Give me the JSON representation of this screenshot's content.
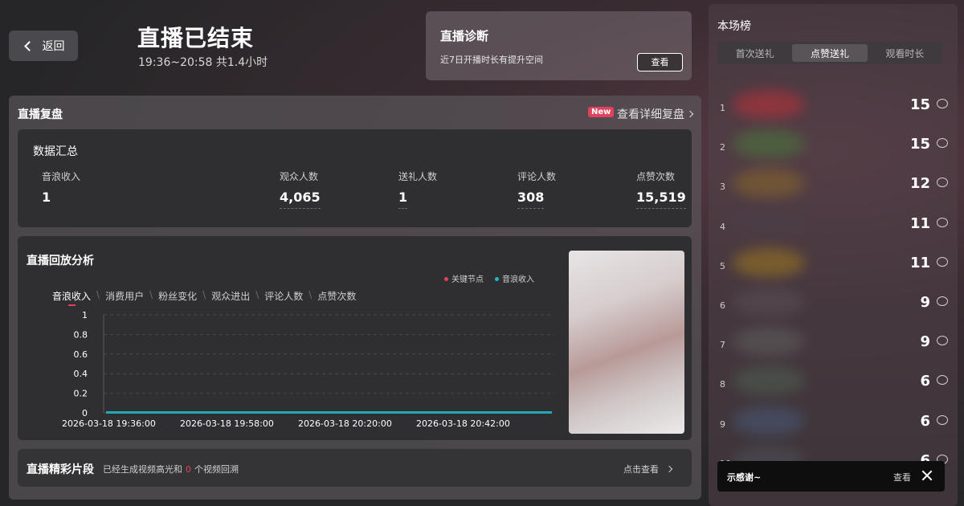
{
  "header": {
    "back_label": "返回",
    "title": "直播已结束",
    "subtitle": "19:36~20:58 共1.4小时"
  },
  "diagnosis": {
    "title": "直播诊断",
    "description": "近7日开播时长有提升空间",
    "button": "查看"
  },
  "review": {
    "title": "直播复盘",
    "new_badge": "New",
    "detail_link": "查看详细复盘",
    "summary": {
      "title": "数据汇总",
      "stats": [
        {
          "label": "音浪收入",
          "value": "1"
        },
        {
          "label": "观众人数",
          "value": "4,065"
        },
        {
          "label": "送礼人数",
          "value": "1"
        },
        {
          "label": "评论人数",
          "value": "308"
        },
        {
          "label": "点赞次数",
          "value": "15,519"
        }
      ]
    },
    "replay": {
      "title": "直播回放分析",
      "legend": [
        {
          "label": "关键节点",
          "color": "#e0425e"
        },
        {
          "label": "音浪收入",
          "color": "#1fb8c9"
        }
      ],
      "tabs": [
        "音浪收入",
        "消费用户",
        "粉丝变化",
        "观众进出",
        "评论人数",
        "点赞次数"
      ],
      "active_tab": 0
    },
    "clips": {
      "title": "直播精彩片段",
      "desc_prefix": "已经生成视频高光和",
      "count": "0",
      "desc_suffix": "个视频回溯",
      "link": "点击查看"
    }
  },
  "chart_data": {
    "type": "area",
    "y_ticks": [
      "0",
      "0.2",
      "0.4",
      "0.6",
      "0.8",
      "1"
    ],
    "ylim": [
      0,
      1
    ],
    "x_ticks": [
      "2026-03-18 19:36:00",
      "2026-03-18 19:58:00",
      "2026-03-18 20:20:00",
      "2026-03-18 20:42:00"
    ],
    "series": [
      {
        "values": [
          0,
          0,
          0,
          0,
          0,
          0,
          0,
          0,
          0,
          0
        ],
        "color": "#1fb8c9"
      }
    ],
    "grid": true
  },
  "ranking": {
    "title": "本场榜",
    "tabs": [
      "首次送礼",
      "点赞送礼",
      "观看时长"
    ],
    "active_tab": 1,
    "rows": [
      {
        "rank": "1",
        "value": "15",
        "tint": "#c0303a"
      },
      {
        "rank": "2",
        "value": "15",
        "tint": "#4a7a3a"
      },
      {
        "rank": "3",
        "value": "12",
        "tint": "#8a6a2a"
      },
      {
        "rank": "4",
        "value": "11",
        "tint": "#4a4048"
      },
      {
        "rank": "5",
        "value": "11",
        "tint": "#a07a20"
      },
      {
        "rank": "6",
        "value": "9",
        "tint": "#5a5058"
      },
      {
        "rank": "7",
        "value": "9",
        "tint": "#606060"
      },
      {
        "rank": "8",
        "value": "6",
        "tint": "#506050"
      },
      {
        "rank": "9",
        "value": "6",
        "tint": "#4a5a7a"
      },
      {
        "rank": "10",
        "value": "6",
        "tint": "#505058"
      }
    ]
  },
  "toast": {
    "text": "示感谢~",
    "view": "查看"
  }
}
